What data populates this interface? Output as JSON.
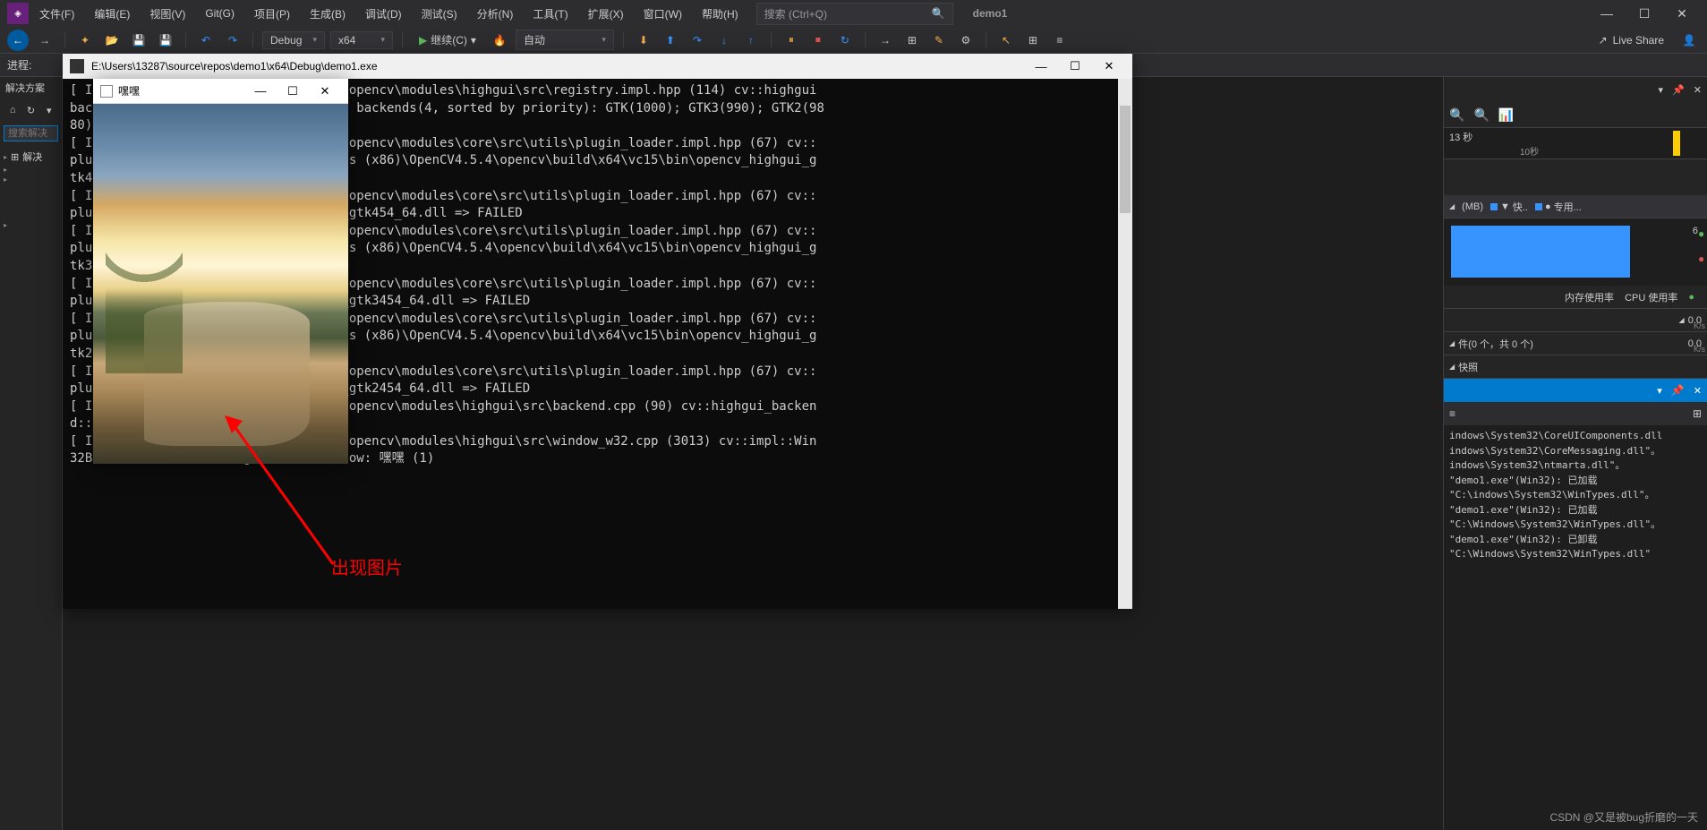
{
  "menubar": {
    "items": [
      "文件(F)",
      "编辑(E)",
      "视图(V)",
      "Git(G)",
      "项目(P)",
      "生成(B)",
      "调试(D)",
      "测试(S)",
      "分析(N)",
      "工具(T)",
      "扩展(X)",
      "窗口(W)",
      "帮助(H)"
    ],
    "search_placeholder": "搜索 (Ctrl+Q)",
    "project": "demo1"
  },
  "toolbar": {
    "config": "Debug",
    "platform": "x64",
    "continue": "继续(C)",
    "auto": "自动",
    "liveshare": "Live Share"
  },
  "process_label": "进程:",
  "left": {
    "title": "解决方案",
    "search_placeholder": "搜索解决",
    "node": "解决"
  },
  "console": {
    "title": "E:\\Users\\13287\\source\\repos\\demo1\\x64\\Debug\\demo1.exe",
    "lines": "[ IN        winpack-build-win64-vc15\\opencv\\modules\\highgui\\src\\registry.impl.hpp (114) cv::highgui\nback        ckendRegistry UI: Enabled backends(4, sorted by priority): GTK(1000); GTK3(990); GTK2(98\n80)\n[ IN        winpack-build-win64-vc15\\opencv\\modules\\core\\src\\utils\\plugin_loader.impl.hpp (67) cv::\nplug        Load load E:\\Program Files (x86)\\OpenCV4.5.4\\opencv\\build\\x64\\vc15\\bin\\opencv_highgui_g\ntk45\n[ IN        winpack-build-win64-vc15\\opencv\\modules\\core\\src\\utils\\plugin_loader.impl.hpp (67) cv::\nplug        Load load opencv_highgui_gtk454_64.dll => FAILED\n[ IN        winpack-build-win64-vc15\\opencv\\modules\\core\\src\\utils\\plugin_loader.impl.hpp (67) cv::\nplug        Load load E:\\Program Files (x86)\\OpenCV4.5.4\\opencv\\build\\x64\\vc15\\bin\\opencv_highgui_g\ntk34\n[ IN        winpack-build-win64-vc15\\opencv\\modules\\core\\src\\utils\\plugin_loader.impl.hpp (67) cv::\nplug        Load load opencv_highgui_gtk3454_64.dll => FAILED\n[ IN        winpack-build-win64-vc15\\opencv\\modules\\core\\src\\utils\\plugin_loader.impl.hpp (67) cv::\nplug        Load load E:\\Program Files (x86)\\OpenCV4.5.4\\opencv\\build\\x64\\vc15\\bin\\opencv_highgui_g\ntk24\n[ IN        winpack-build-win64-vc15\\opencv\\modules\\core\\src\\utils\\plugin_loader.impl.hpp (67) cv::\nplug        Load load opencv_highgui_gtk2454_64.dll => FAILED\n[ IN        winpack-build-win64-vc15\\opencv\\modules\\highgui\\src\\backend.cpp (90) cv::highgui_backen\nd::c        end: WIN32 (priority=970)\n[ IN        winpack-build-win64-vc15\\opencv\\modules\\highgui\\src\\window_w32.cpp (3013) cv::impl::Win\n32Ba        UI: Creating Win32UI window: 嘿嘿 (1)"
  },
  "image_win": {
    "title": "嘿嘿"
  },
  "annotation": "出现图片",
  "diag": {
    "session_label": "13 秒",
    "tick_10s": "10秒",
    "mem_title": "(MB)",
    "legend_fast": "快..",
    "legend_dedicated": "专用...",
    "mem_value": "6",
    "mem_use": "内存使用率",
    "cpu_use": "CPU 使用率",
    "zero1": "0.0",
    "ks": "K/s",
    "events": "件(0 个，共 0 个)",
    "snapshot": "快照"
  },
  "output": {
    "lines": "indows\\System32\\CoreUIComponents.dll\nindows\\System32\\CoreMessaging.dll\"。\nindows\\System32\\ntmarta.dll\"。\n\"demo1.exe\"(Win32): 已加载 \"C:\\indows\\System32\\WinTypes.dll\"。\n\"demo1.exe\"(Win32): 已加载 \"C:\\Windows\\System32\\WinTypes.dll\"。\n\"demo1.exe\"(Win32): 已卸载 \"C:\\Windows\\System32\\WinTypes.dll\""
  },
  "watermark": "CSDN @又是被bug折磨的一天"
}
